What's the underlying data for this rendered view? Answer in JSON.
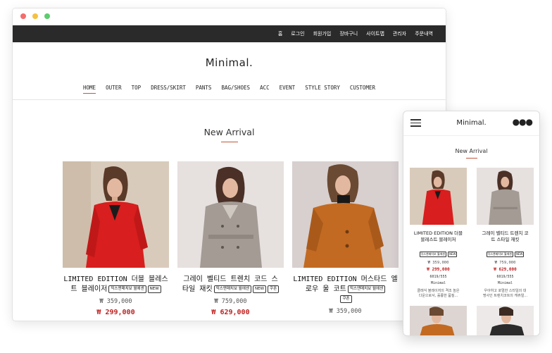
{
  "desktop": {
    "topbar": [
      "홈",
      "로그인",
      "회원가입",
      "장바구니",
      "사이트맵",
      "관리자",
      "주문내역"
    ],
    "brand": "Minimal.",
    "nav": [
      "HOME",
      "OUTER",
      "TOP",
      "DRESS/SKIRT",
      "PANTS",
      "BAG/SHOES",
      "ACC",
      "EVENT",
      "STYLE STORY",
      "CUSTOMER"
    ],
    "section_title": "New Arrival",
    "products": [
      {
        "name_line1": "LIMITED EDITION 더블 블레스",
        "name_line2": "트 블레이저",
        "tags": [
          "믹스앤매치보 월에센",
          "NEW"
        ],
        "price": "₩ 359,000",
        "sale": "₩ 299,000"
      },
      {
        "name_line1": "그레이 벨티드 트렌치 코드 스",
        "name_line2": "타일 재킷",
        "tags": [
          "믹스앤매치보 월에센",
          "NEW",
          "쿠폰"
        ],
        "price": "₩ 759,000",
        "sale": "₩ 629,000"
      },
      {
        "name_line1": "LIMITED EDITION 머스타드 엘",
        "name_line2": "로우 울 코트",
        "tags": [
          "믹스앤매치보 월에센",
          "쿠폰"
        ],
        "price": "₩ 359,000",
        "sale": ""
      }
    ]
  },
  "mobile": {
    "brand": "Minimal.",
    "section_title": "New Arrival",
    "products": [
      {
        "name_line1": "LIMITED EDITION 더블",
        "name_line2": "블레스트 블레이저",
        "tags": [
          "믹스앤매치보 월에센",
          "NEW"
        ],
        "price": "₩ 359,000",
        "sale": "₩ 299,000",
        "code": "6019/555",
        "brand": "Minimal",
        "desc_line1": "클래식 블레이저의 격조 높은",
        "desc_line2": "다운으로서, 훌륭한 품질..."
      },
      {
        "name_line1": "그레이 벨티드 트렌치 코",
        "name_line2": "트 스타일 재킷",
        "tags": [
          "믹스앤매치보 월에센",
          "NEW"
        ],
        "price": "₩ 759,000",
        "sale": "₩ 629,000",
        "code": "6019/555",
        "brand": "Minimal",
        "desc_line1": "우아하고 포멀한 스타일의 대",
        "desc_line2": "명사인 트렌치코트의 캐쥬얼..."
      }
    ]
  }
}
